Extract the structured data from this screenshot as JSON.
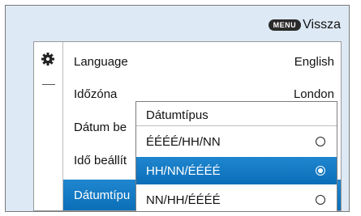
{
  "header": {
    "menu_badge": "MENU",
    "back_label": "Vissza"
  },
  "settings": {
    "rows": [
      {
        "label": "Language",
        "value": "English"
      },
      {
        "label": "Időzóna",
        "value": "London"
      },
      {
        "label": "Dátum be",
        "value": ""
      },
      {
        "label": "Idő beállít",
        "value": ""
      },
      {
        "label": "Dátumtípu",
        "value": ""
      }
    ]
  },
  "popup": {
    "title": "Dátumtípus",
    "options": [
      {
        "label": "ÉÉÉÉ/HH/NN",
        "selected": false
      },
      {
        "label": "HH/NN/ÉÉÉÉ",
        "selected": true
      },
      {
        "label": "NN/HH/ÉÉÉÉ",
        "selected": false
      }
    ]
  },
  "colors": {
    "highlight": "#0b6fb8",
    "background": "#dde9f4"
  },
  "icons": {
    "settings": "gear-icon"
  }
}
